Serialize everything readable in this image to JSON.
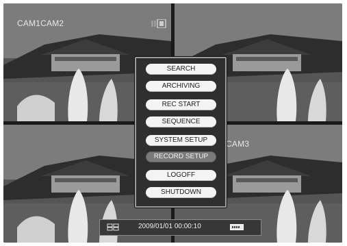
{
  "overlay": {
    "cam_label_top": "CAM1CAM2",
    "cam_label_mid": "CAM3"
  },
  "menu": {
    "items": [
      {
        "label": "SEARCH"
      },
      {
        "label": "ARCHIVING"
      },
      {
        "label": "REC START"
      },
      {
        "label": "SEQUENCE"
      },
      {
        "label": "SYSTEM SETUP"
      },
      {
        "label": "RECORD SETUP",
        "selected": true
      },
      {
        "label": "LOGOFF"
      },
      {
        "label": "SHUTDOWN"
      }
    ]
  },
  "status_bar": {
    "datetime": "2009/01/01 00:00:10",
    "left_icon": "camera-group-icon",
    "right_icon": "hdd-icon"
  }
}
